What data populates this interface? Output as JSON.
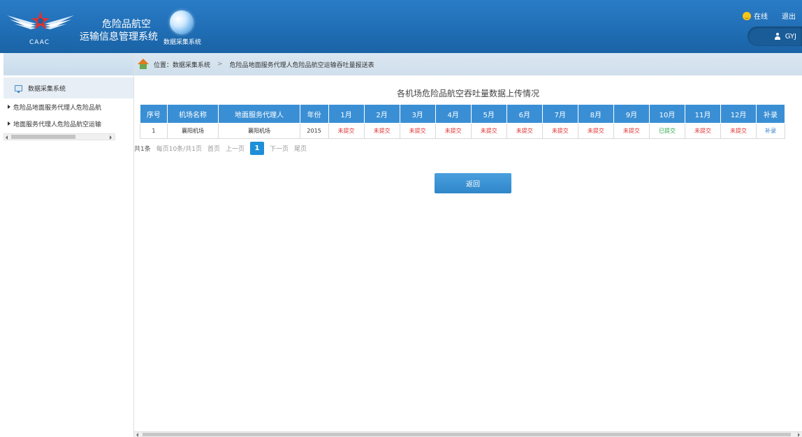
{
  "header": {
    "logo_text": "CAAC",
    "title_line1": "危险品航空",
    "title_line2": "运输信息管理系统",
    "module_name": "数据采集系统",
    "online_label": "在线",
    "logout_label": "退出",
    "username": "GYJ",
    "colors": {
      "header_bg": "#2a7cc7",
      "accent": "#1d8fd8"
    }
  },
  "sidebar": {
    "head_label": "数据采集系统",
    "items": [
      {
        "label": "危险品地面服务代理人危险品航"
      },
      {
        "label": "地面服务代理人危险品航空运输"
      }
    ]
  },
  "breadcrumb": {
    "prefix": "位置：数据采集系统",
    "separator": ">",
    "current": "危险品地面服务代理人危险品航空运输吞吐量报送表"
  },
  "main": {
    "table_title": "各机场危险品航空吞吐量数据上传情况",
    "columns": [
      "序号",
      "机场名称",
      "地面服务代理人",
      "年份",
      "1月",
      "2月",
      "3月",
      "4月",
      "5月",
      "6月",
      "7月",
      "8月",
      "9月",
      "10月",
      "11月",
      "12月",
      "补录"
    ],
    "rows": [
      {
        "index": "1",
        "airport": "襄阳机场",
        "agent": "襄阳机场",
        "year": "2015",
        "months": [
          "未提交",
          "未提交",
          "未提交",
          "未提交",
          "未提交",
          "未提交",
          "未提交",
          "未提交",
          "未提交",
          "已提交",
          "未提交",
          "未提交"
        ],
        "action": "补录"
      }
    ],
    "status_colors": {
      "未提交": "#e03030",
      "已提交": "#2ea84a"
    },
    "pager": {
      "total": "共1条",
      "per_page": "每页10条/共1页",
      "first": "首页",
      "prev": "上一页",
      "current": "1",
      "next": "下一页",
      "last": "尾页"
    },
    "back_label": "返回"
  }
}
